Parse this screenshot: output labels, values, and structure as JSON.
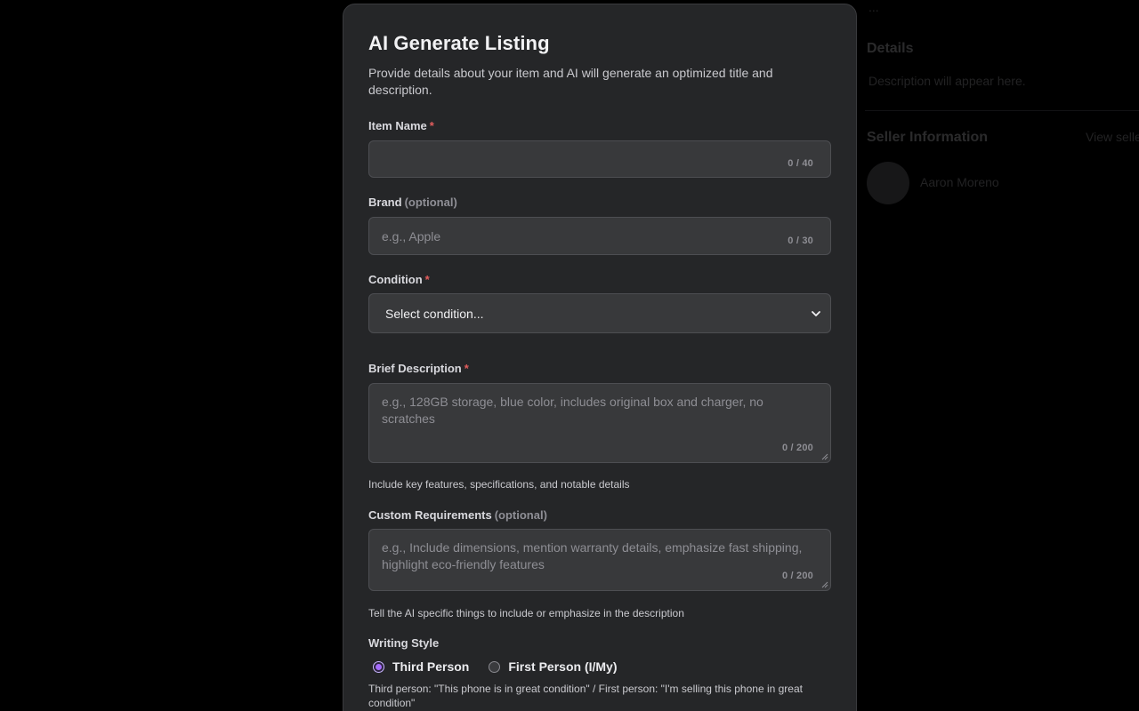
{
  "background": {
    "line1": "...",
    "heading1": "Details",
    "line2": "Description will appear here.",
    "heading2": "Seller Information",
    "heading2_right": "View seller",
    "seller_name": "Aaron Moreno"
  },
  "modal": {
    "title": "AI Generate Listing",
    "subtitle": "Provide details about your item and AI will generate an optimized title and description."
  },
  "item_name": {
    "label": "Item Name",
    "required_mark": "*",
    "value": "",
    "placeholder": "",
    "counter": "0 / 40"
  },
  "brand": {
    "label": "Brand",
    "optional": "(optional)",
    "placeholder": "e.g., Apple",
    "counter": "0 / 30"
  },
  "condition": {
    "label": "Condition",
    "required_mark": "*",
    "selected": "Select condition..."
  },
  "description": {
    "label": "Brief Description",
    "required_mark": "*",
    "placeholder": "e.g., 128GB storage, blue color, includes original box and charger, no scratches",
    "counter": "0 / 200",
    "hint": "Include key features, specifications, and notable details"
  },
  "custom": {
    "label": "Custom Requirements",
    "optional": "(optional)",
    "placeholder": "e.g., Include dimensions, mention warranty details, emphasize fast shipping, highlight eco-friendly features",
    "counter": "0 / 200",
    "hint": "Tell the AI specific things to include or emphasize in the description"
  },
  "writing_style": {
    "label": "Writing Style",
    "options": [
      "Third Person",
      "First Person (I/My)"
    ],
    "selected_index": 0,
    "hint": "Third person: \"This phone is in great condition\" / First person: \"I'm selling this phone in great condition\""
  },
  "colors": {
    "accent": "#a66cff",
    "required": "#e35d5d"
  }
}
